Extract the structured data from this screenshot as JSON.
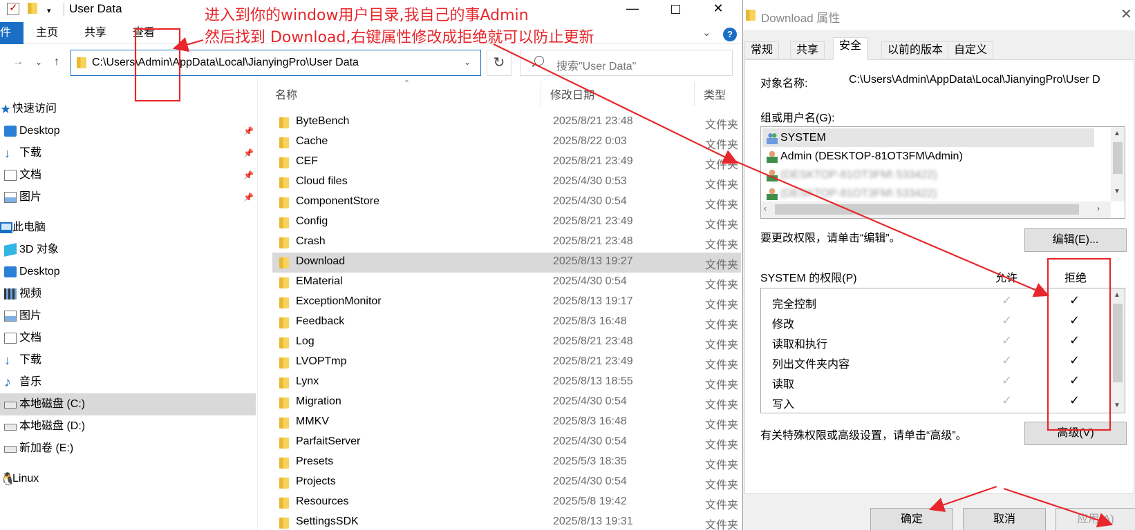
{
  "explorer": {
    "title": "User Data",
    "window_controls": {
      "minimize": "—",
      "close": "✕"
    },
    "ribbon": {
      "file": "件",
      "home": "主页",
      "share": "共享",
      "view": "查看"
    },
    "address": "C:\\Users\\Admin\\AppData\\Local\\JianyingPro\\User Data",
    "search_placeholder": "搜索\"User Data\"",
    "columns": {
      "name": "名称",
      "date": "修改日期",
      "type": "类型"
    },
    "sidebar": [
      {
        "label": "快速访问",
        "icon": "star-icon"
      },
      {
        "label": "Desktop",
        "icon": "desktop-icon",
        "pinned": true
      },
      {
        "label": "下载",
        "icon": "download-icon",
        "pinned": true
      },
      {
        "label": "文档",
        "icon": "document-icon",
        "pinned": true
      },
      {
        "label": "图片",
        "icon": "picture-icon",
        "pinned": true
      },
      {
        "label": "此电脑",
        "icon": "computer-icon"
      },
      {
        "label": "3D 对象",
        "icon": "3d-objects-icon"
      },
      {
        "label": "Desktop",
        "icon": "desktop-icon"
      },
      {
        "label": "视频",
        "icon": "video-icon"
      },
      {
        "label": "图片",
        "icon": "picture-icon"
      },
      {
        "label": "文档",
        "icon": "document-icon"
      },
      {
        "label": "下载",
        "icon": "download-icon"
      },
      {
        "label": "音乐",
        "icon": "music-icon"
      },
      {
        "label": "本地磁盘 (C:)",
        "icon": "drive-icon",
        "selected": true
      },
      {
        "label": "本地磁盘 (D:)",
        "icon": "drive-icon"
      },
      {
        "label": "新加卷 (E:)",
        "icon": "drive-icon"
      },
      {
        "label": "Linux",
        "icon": "linux-icon"
      }
    ],
    "files": [
      {
        "name": "ByteBench",
        "date": "2025/8/21 23:48",
        "type": "文件夹"
      },
      {
        "name": "Cache",
        "date": "2025/8/22 0:03",
        "type": "文件夹"
      },
      {
        "name": "CEF",
        "date": "2025/8/21 23:49",
        "type": "文件夹"
      },
      {
        "name": "Cloud files",
        "date": "2025/4/30 0:53",
        "type": "文件夹"
      },
      {
        "name": "ComponentStore",
        "date": "2025/4/30 0:54",
        "type": "文件夹"
      },
      {
        "name": "Config",
        "date": "2025/8/21 23:49",
        "type": "文件夹"
      },
      {
        "name": "Crash",
        "date": "2025/8/21 23:48",
        "type": "文件夹"
      },
      {
        "name": "Download",
        "date": "2025/8/13 19:27",
        "type": "文件夹",
        "selected": true
      },
      {
        "name": "EMaterial",
        "date": "2025/4/30 0:54",
        "type": "文件夹"
      },
      {
        "name": "ExceptionMonitor",
        "date": "2025/8/13 19:17",
        "type": "文件夹"
      },
      {
        "name": "Feedback",
        "date": "2025/8/3 16:48",
        "type": "文件夹"
      },
      {
        "name": "Log",
        "date": "2025/8/21 23:48",
        "type": "文件夹"
      },
      {
        "name": "LVOPTmp",
        "date": "2025/8/21 23:49",
        "type": "文件夹"
      },
      {
        "name": "Lynx",
        "date": "2025/8/13 18:55",
        "type": "文件夹"
      },
      {
        "name": "Migration",
        "date": "2025/4/30 0:54",
        "type": "文件夹"
      },
      {
        "name": "MMKV",
        "date": "2025/8/3 16:48",
        "type": "文件夹"
      },
      {
        "name": "ParfaitServer",
        "date": "2025/4/30 0:54",
        "type": "文件夹"
      },
      {
        "name": "Presets",
        "date": "2025/5/3 18:35",
        "type": "文件夹"
      },
      {
        "name": "Projects",
        "date": "2025/4/30 0:54",
        "type": "文件夹"
      },
      {
        "name": "Resources",
        "date": "2025/5/8 19:42",
        "type": "文件夹"
      },
      {
        "name": "SettingsSDK",
        "date": "2025/8/13 19:31",
        "type": "文件夹"
      }
    ]
  },
  "dialog": {
    "title": "Download 属性",
    "tabs": [
      "常规",
      "共享",
      "安全",
      "以前的版本",
      "自定义"
    ],
    "active_tab": "安全",
    "object_name_label": "对象名称:",
    "object_name": "C:\\Users\\Admin\\AppData\\Local\\JianyingPro\\User D",
    "group_label": "组或用户名(G):",
    "users": [
      {
        "name": "SYSTEM",
        "icon": "group-icon",
        "selected": true
      },
      {
        "name": "Admin (DESKTOP-81OT3FM\\Admin)",
        "icon": "user-icon"
      },
      {
        "name": "(DESKTOP-81OT3FM\\ 533422)",
        "icon": "user-icon",
        "blurred": true
      },
      {
        "name": "(DESKTOP-81OT3FM\\ 533422)",
        "icon": "user-icon",
        "blurred": true
      }
    ],
    "change_hint": "要更改权限，请单击“编辑”。",
    "edit_button": "编辑(E)...",
    "perm_label": "SYSTEM 的权限(P)",
    "allow_header": "允许",
    "deny_header": "拒绝",
    "permissions": [
      {
        "name": "完全控制",
        "allow": true,
        "deny": true
      },
      {
        "name": "修改",
        "allow": true,
        "deny": true
      },
      {
        "name": "读取和执行",
        "allow": true,
        "deny": true
      },
      {
        "name": "列出文件夹内容",
        "allow": true,
        "deny": true
      },
      {
        "name": "读取",
        "allow": true,
        "deny": true
      },
      {
        "name": "写入",
        "allow": true,
        "deny": true
      }
    ],
    "advanced_hint": "有关特殊权限或高级设置，请单击“高级”。",
    "advanced_button": "高级(V)",
    "ok_button": "确定",
    "cancel_button": "取消",
    "apply_button": "应用(A)"
  },
  "annotation": {
    "line1": "进入到你的window用户目录,我自己的事Admin",
    "line2": "然后找到 Download,右键属性修改成拒绝就可以防止更新",
    "color": "#e8262b"
  }
}
